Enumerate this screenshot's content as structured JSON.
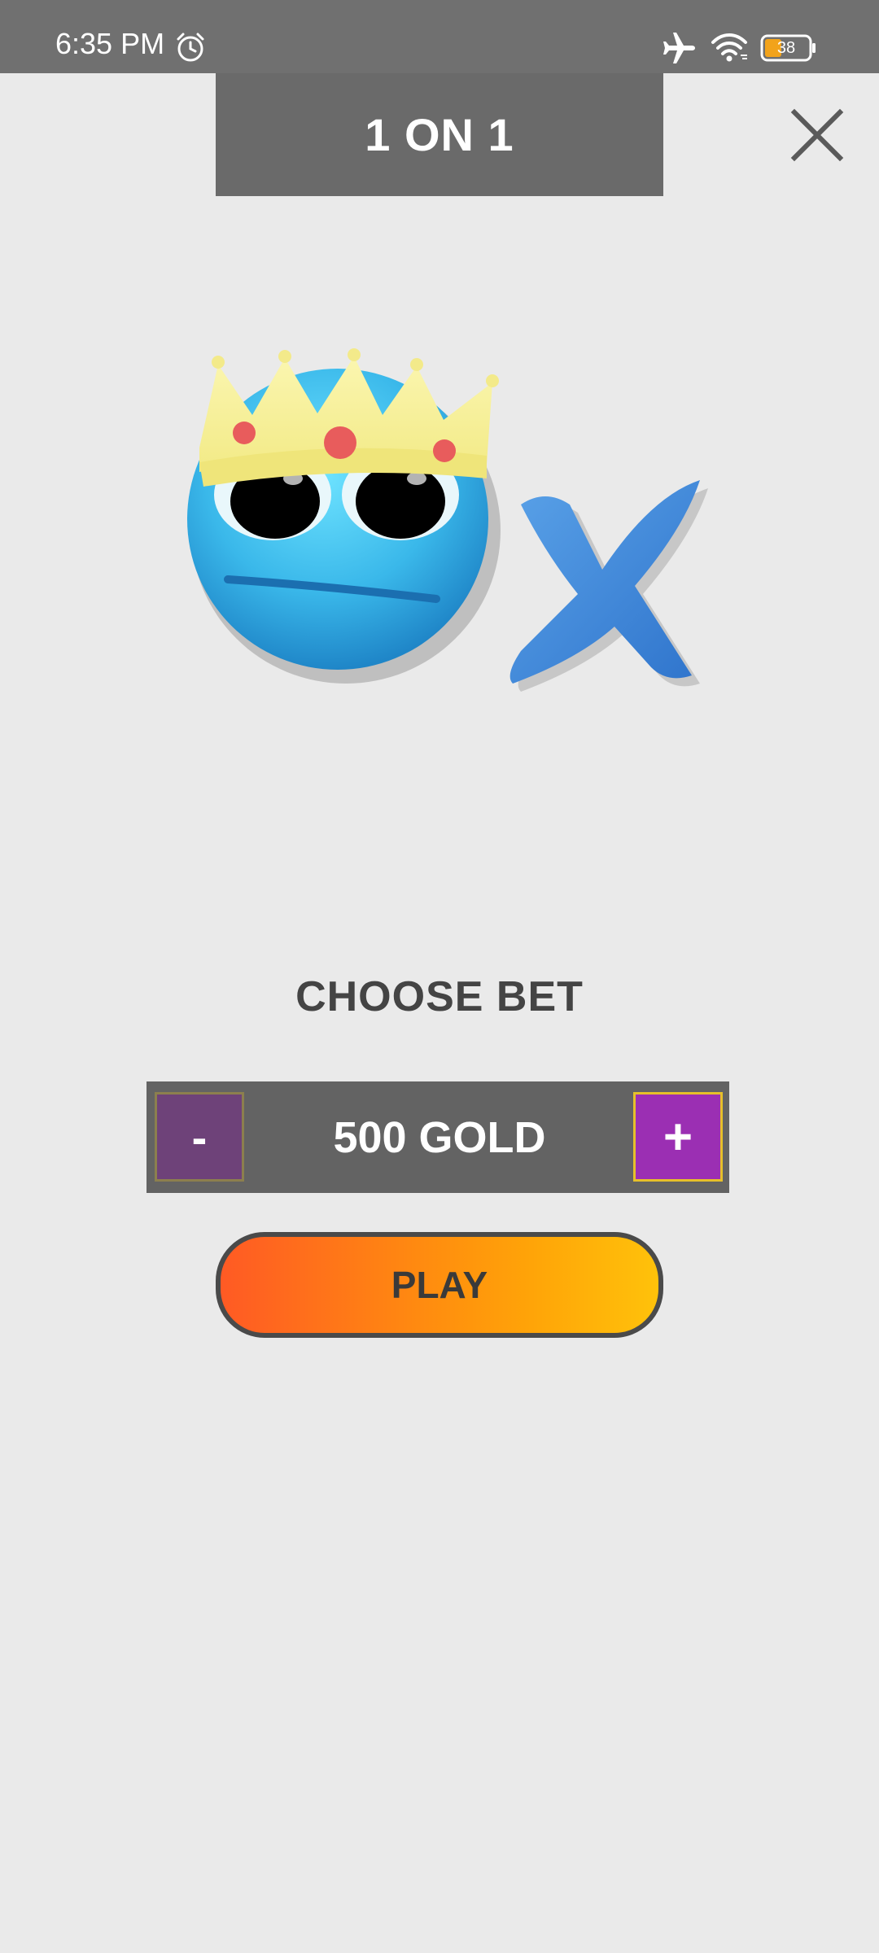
{
  "status_bar": {
    "time": "6:35 PM",
    "alarm_icon": "alarm-clock-icon",
    "airplane_icon": "airplane-mode-icon",
    "wifi_icon": "wifi-icon",
    "battery_icon": "battery-icon",
    "battery_level": "38"
  },
  "header": {
    "title": "1 ON 1",
    "close_icon": "close-icon"
  },
  "illustration": {
    "emoji": "crowned-blue-face",
    "mark": "blue-x-mark"
  },
  "bet": {
    "heading": "CHOOSE BET",
    "decrease_label": "-",
    "increase_label": "+",
    "value": "500 GOLD"
  },
  "play": {
    "label": "PLAY"
  },
  "colors": {
    "background": "#eaeaea",
    "header_tab": "#6a6a6a",
    "bet_box": "#636363",
    "minus_button": "#6e4279",
    "plus_button": "#9b2fb3",
    "play_gradient_start": "#ff5a24",
    "play_gradient_end": "#ffc20a"
  }
}
